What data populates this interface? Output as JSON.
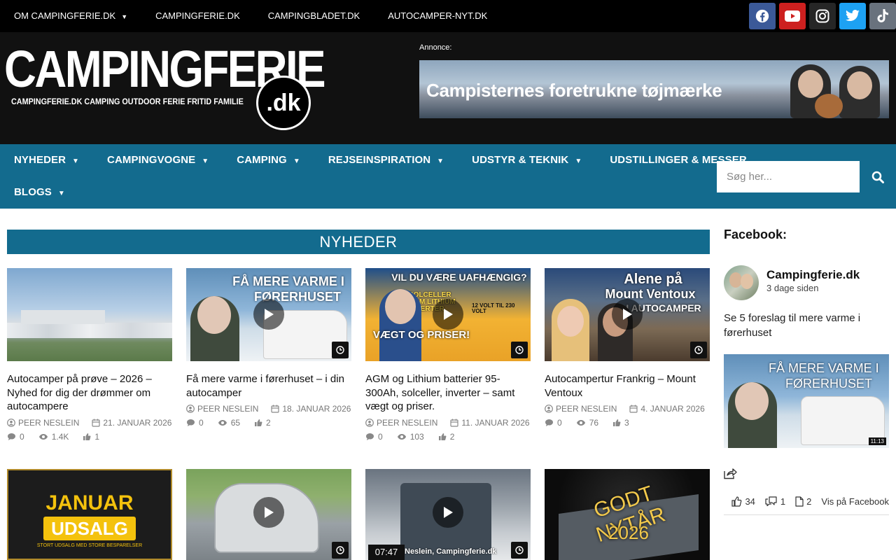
{
  "topnav": {
    "items": [
      {
        "label": "OM CAMPINGFERIE.DK",
        "has_caret": true
      },
      {
        "label": "CAMPINGFERIE.DK"
      },
      {
        "label": "CAMPINGBLADET.DK"
      },
      {
        "label": "AUTOCAMPER-NYT.DK"
      }
    ],
    "social": [
      {
        "icon": "facebook-icon",
        "color": "#3b5998"
      },
      {
        "icon": "youtube-icon",
        "color": "#cd201f"
      },
      {
        "icon": "instagram-icon",
        "color": "#262626"
      },
      {
        "icon": "twitter-icon",
        "color": "#1da1f2"
      },
      {
        "icon": "tiktok-icon",
        "color": "#69727d"
      }
    ]
  },
  "header": {
    "logo_main": "CAMPINGFERIE",
    "logo_sub": "CAMPINGFERIE.DK  CAMPING  OUTDOOR  FERIE  FRITID  FAMILIE",
    "logo_dk": ".dk",
    "ad_label": "Annonce:",
    "ad_text": "Campisternes foretrukne tøjmærke"
  },
  "mainnav": {
    "row1": [
      {
        "label": "NYHEDER",
        "has_caret": true
      },
      {
        "label": "CAMPINGVOGNE",
        "has_caret": true
      },
      {
        "label": "CAMPING",
        "has_caret": true
      },
      {
        "label": "REJSEINSPIRATION",
        "has_caret": true
      },
      {
        "label": "UDSTYR & TEKNIK",
        "has_caret": true
      },
      {
        "label": "UDSTILLINGER & MESSER",
        "has_caret": false
      }
    ],
    "row2": [
      {
        "label": "BLOGS",
        "has_caret": true
      }
    ],
    "search_placeholder": "Søg her..."
  },
  "section": {
    "title": "NYHEDER"
  },
  "articles": [
    {
      "title": "Autocamper på prøve – 2026 – Nyhed for dig der drømmer om autocampere",
      "author": "PEER NESLEIN",
      "date": "21. JANUAR 2026",
      "comments": "0",
      "views": "1.4K",
      "likes": "1"
    },
    {
      "title": "Få mere varme i førerhuset – i din autocamper",
      "author": "PEER NESLEIN",
      "date": "18. JANUAR 2026",
      "comments": "0",
      "views": "65",
      "likes": "2",
      "thumb_caption_1": "FÅ MERE VARME I",
      "thumb_caption_2": "FØRERHUSET"
    },
    {
      "title": "AGM og Lithium batterier 95-300Ah, solceller, inverter – samt vægt og priser.",
      "author": "PEER NESLEIN",
      "date": "11. JANUAR 2026",
      "comments": "0",
      "views": "103",
      "likes": "2",
      "thumb_caption_1": "VIL DU VÆRE UAFHÆNGIG?",
      "thumb_caption_2": "SOLCELLER AGM LITHIUM INVERTER",
      "thumb_caption_3": "12 VOLT TIL 230 VOLT",
      "thumb_caption_4": "VÆGT OG PRISER!"
    },
    {
      "title": "Autocampertur Frankrig – Mount Ventoux",
      "author": "PEER NESLEIN",
      "date": "4. JANUAR 2026",
      "comments": "0",
      "views": "76",
      "likes": "3",
      "thumb_caption_1": "Alene på",
      "thumb_caption_2": "Mount Ventoux",
      "thumb_caption_3": "i autocamper"
    }
  ],
  "row2": {
    "card1_caption_1": "JANUAR",
    "card1_caption_2": "UDSALG",
    "card1_caption_3": "STORT UDSALG MED STORE BESPARELSER",
    "card3_duration": "07:47",
    "card3_caption": "Neslein, Campingferie.dk",
    "card4_caption_1": "GODT NYTÅR",
    "card4_caption_2": "2026"
  },
  "sidebar": {
    "heading": "Facebook:",
    "page_name": "Campingferie.dk",
    "time": "3 dage siden",
    "post_text": "Se 5 foreslag til mere varme i førerhuset",
    "img_caption_1": "FÅ MERE VARME I",
    "img_caption_2": "FØRERHUSET",
    "img_duration": "11:13",
    "likes": "34",
    "comments": "1",
    "shares": "2",
    "view_link": "Vis på Facebook"
  }
}
